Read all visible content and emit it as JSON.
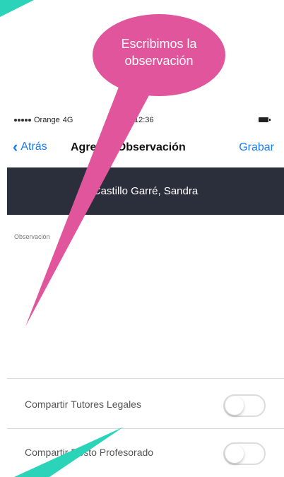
{
  "callout": {
    "text_line1": "Escribimos la",
    "text_line2": "observación",
    "color": "#e1559c"
  },
  "status_bar": {
    "carrier": "Orange",
    "network": "4G",
    "time": "12:36"
  },
  "nav": {
    "back_label": "Atrás",
    "title": "Agregar Observación",
    "save_label": "Grabar"
  },
  "student": {
    "name": "Castillo Garré, Sandra"
  },
  "observation": {
    "label": "Observación",
    "value": ""
  },
  "toggles": [
    {
      "label": "Compartir Tutores Legales",
      "on": false
    },
    {
      "label": "Compartir Resto Profesorado",
      "on": false
    }
  ],
  "colors": {
    "accent": "#1a7cf5",
    "band": "#2a2f3b",
    "teal": "#2bd3b8",
    "pink": "#e1559c"
  }
}
